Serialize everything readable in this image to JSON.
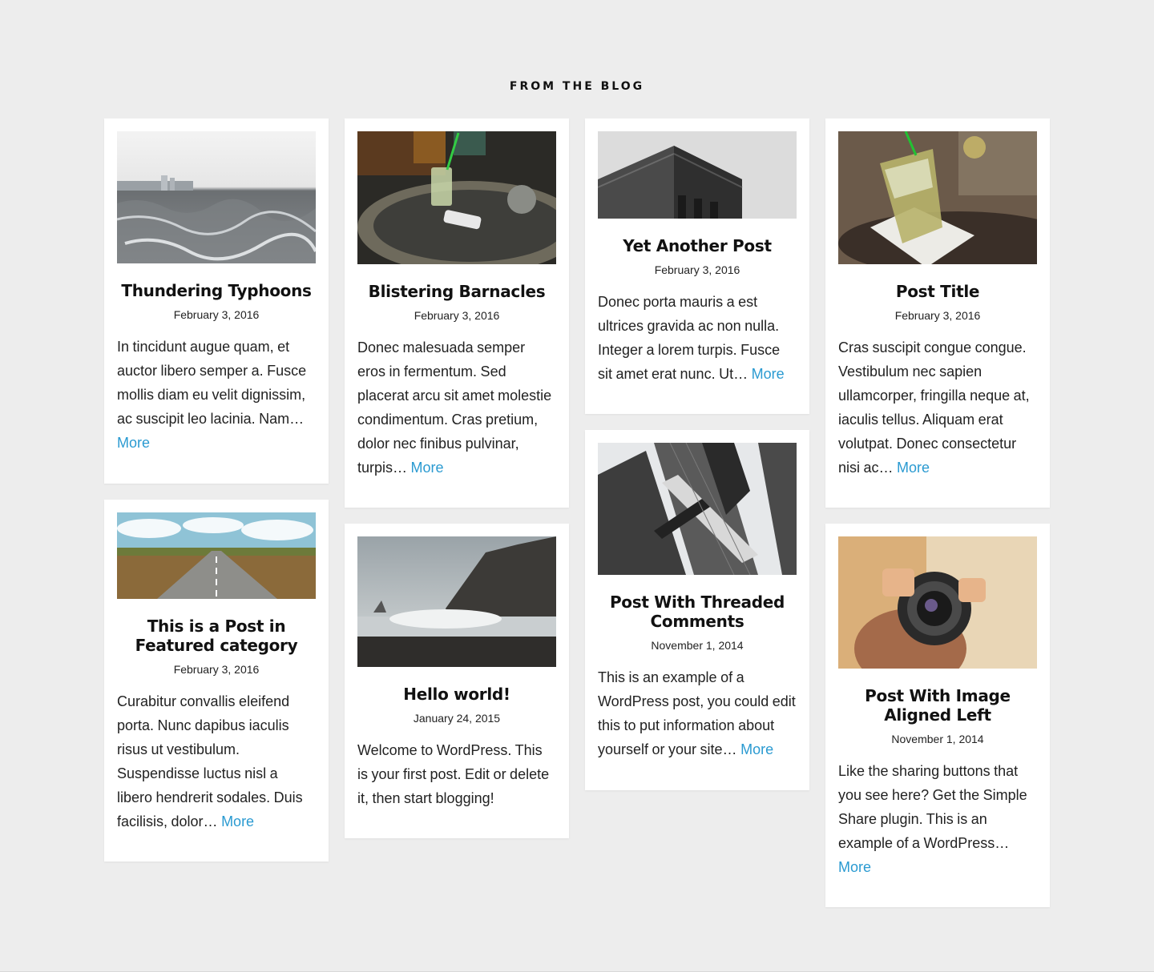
{
  "section": {
    "title": "FROM THE BLOG"
  },
  "posts": [
    {
      "title": "Thundering Typhoons",
      "date": "February 3, 2016",
      "excerpt": "In tincidunt augue quam, et auctor libero semper a. Fusce mollis diam eu velit dignissim, ac suscipit leo lacinia. Nam…",
      "more": "More",
      "image": "ocean-icon"
    },
    {
      "title": "Blistering Barnacles",
      "date": "February 3, 2016",
      "excerpt": "Donec malesuada semper eros in fermentum. Sed placerat arcu sit amet molestie condimentum. Cras pretium, dolor nec finibus pulvinar, turpis…",
      "more": "More",
      "image": "cafe-table-icon"
    },
    {
      "title": "Yet Another Post",
      "date": "February 3, 2016",
      "excerpt": "Donec porta mauris a est ultrices gravida ac non nulla. Integer a lorem turpis. Fusce sit amet erat nunc. Ut…",
      "more": "More",
      "image": "building-corner-icon"
    },
    {
      "title": "Post Title",
      "date": "February 3, 2016",
      "excerpt": "Cras suscipit congue congue. Vestibulum nec sapien ullamcorper, fringilla neque at, iaculis tellus. Aliquam erat volutpat. Donec consectetur nisi ac…",
      "more": "More",
      "image": "drink-glass-icon"
    },
    {
      "title": "This is a Post in Featured category",
      "date": "February 3, 2016",
      "excerpt": "Curabitur convallis eleifend porta. Nunc dapibus iaculis risus ut vestibulum. Suspendisse luctus nisl a libero hendrerit sodales. Duis facilisis, dolor…",
      "more": "More",
      "image": "road-icon"
    },
    {
      "title": "Hello world!",
      "date": "January 24, 2015",
      "excerpt": "Welcome to WordPress. This is your first post. Edit or delete it, then start blogging!",
      "more": "",
      "image": "coast-icon"
    },
    {
      "title": "Post With Threaded Comments",
      "date": "November 1, 2014",
      "excerpt": "This is an example of a WordPress post, you could edit this to put information about yourself or your site…",
      "more": "More",
      "image": "skyscraper-icon"
    },
    {
      "title": "Post With Image Aligned Left",
      "date": "November 1, 2014",
      "excerpt": "Like the sharing buttons that you see here? Get the Simple Share plugin. This is an example of a WordPress…",
      "more": "More",
      "image": "camera-icon"
    }
  ],
  "colors": {
    "background": "#ededed",
    "card": "#ffffff",
    "link": "#2a9ad1",
    "text": "#222222"
  }
}
